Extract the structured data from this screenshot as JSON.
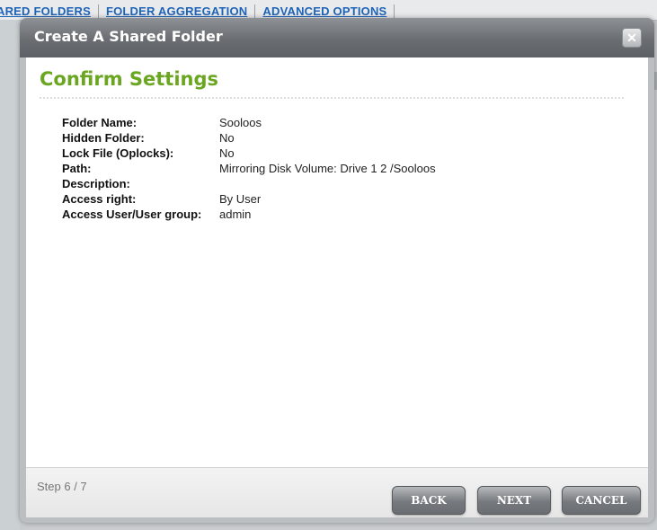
{
  "background": {
    "tabs": [
      "ARED FOLDERS",
      "FOLDER AGGREGATION",
      "ADVANCED OPTIONS"
    ]
  },
  "dialog": {
    "title": "Create A Shared Folder",
    "close_icon": "close-icon",
    "heading": "Confirm Settings",
    "fields": [
      {
        "label": "Folder Name:",
        "value": "Sooloos"
      },
      {
        "label": "Hidden Folder:",
        "value": "No"
      },
      {
        "label": "Lock File (Oplocks):",
        "value": "No"
      },
      {
        "label": "Path:",
        "value": "Mirroring Disk Volume: Drive 1 2 /Sooloos"
      },
      {
        "label": "Description:",
        "value": ""
      },
      {
        "label": "Access right:",
        "value": "By User"
      },
      {
        "label": "Access User/User group:",
        "value": "admin"
      }
    ],
    "step": "Step 6 / 7",
    "buttons": {
      "back": "BACK",
      "next": "NEXT",
      "cancel": "CANCEL"
    }
  },
  "colors": {
    "heading": "#6aa620",
    "title_bar": "#6a6d71",
    "tab_link": "#1d63b8"
  }
}
